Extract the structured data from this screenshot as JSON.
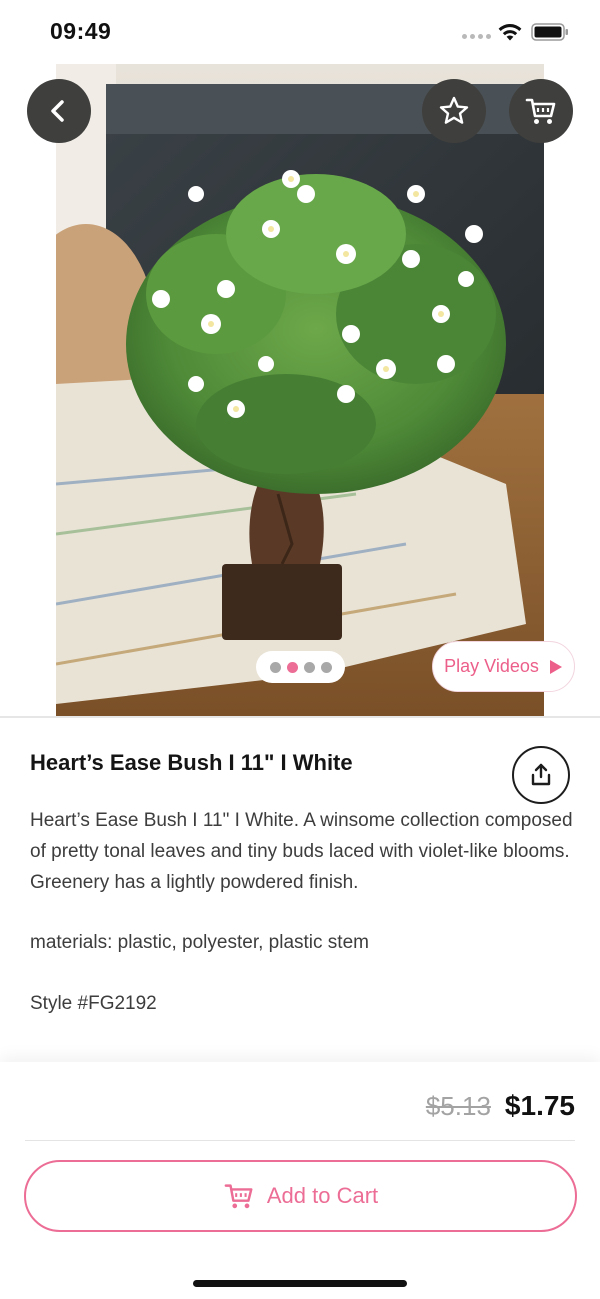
{
  "status_bar": {
    "time": "09:49",
    "icons": [
      "signal-dots-icon",
      "wifi-icon",
      "battery-icon"
    ]
  },
  "header": {
    "back_icon": "chevron-left-icon",
    "favorite_icon": "star-icon",
    "cart_icon": "cart-icon"
  },
  "gallery": {
    "image_count": 4,
    "active_index": 1,
    "play_videos_label": "Play Videos",
    "play_icon": "play-icon"
  },
  "product": {
    "title": "Heart’s Ease Bush I 11\" I White",
    "description": "Heart’s Ease Bush I 11\" I White. A winsome collection composed of pretty tonal leaves and tiny buds laced with violet-like blooms.  Greenery has a lightly powdered finish.",
    "materials": "materials: plastic, polyester, plastic stem",
    "style": "Style #FG2192",
    "share_icon": "share-icon"
  },
  "purchase": {
    "old_price": "$5.13",
    "new_price": "$1.75",
    "add_to_cart_label": "Add to Cart",
    "cart_icon": "cart-icon"
  },
  "colors": {
    "accent": "#ec6d95",
    "overlay_button": "#3f3f3d",
    "text_primary": "#151515",
    "text_secondary": "#3d3d3d",
    "strike_price": "#a3a3a3"
  }
}
